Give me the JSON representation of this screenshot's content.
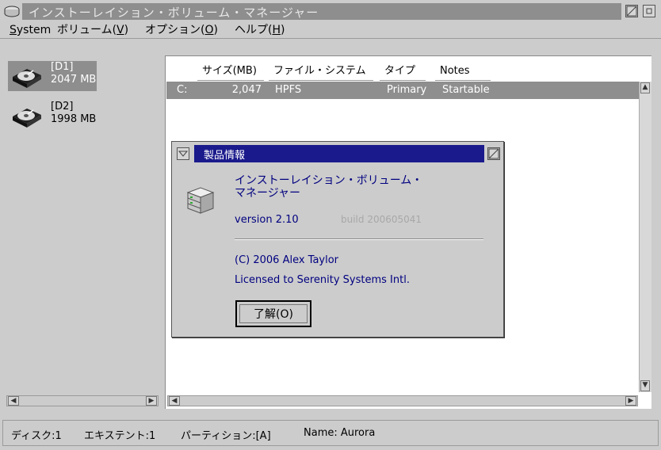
{
  "window": {
    "title": "インストーレイション・ボリューム・マネージャー"
  },
  "menu": [
    {
      "label": "System",
      "key": "S"
    },
    {
      "label": "ボリューム(V)",
      "key": "V"
    },
    {
      "label": "オプション(O)",
      "key": "O"
    },
    {
      "label": "ヘルプ(H)",
      "key": "H"
    }
  ],
  "disks": [
    {
      "name": "[D1]",
      "size": "2047 MB",
      "selected": true
    },
    {
      "name": "[D2]",
      "size": "1998 MB",
      "selected": false
    }
  ],
  "partitions": {
    "columns": [
      "サイズ(MB)",
      "ファイル・システム",
      "タイプ",
      "Notes"
    ],
    "rows": [
      {
        "drive": "C:",
        "size": "2,047",
        "filesystem": "HPFS",
        "type": "Primary",
        "notes": "Startable"
      }
    ]
  },
  "status": {
    "disk": "ディスク:1",
    "extent": "エキステント:1",
    "partition": "パーティション:[A]",
    "name": "Name: Aurora"
  },
  "dialog": {
    "title": "製品情報",
    "product_line1": "インストーレイション・ボリューム・",
    "product_line2": "マネージャー",
    "version": "version 2.10",
    "build": "build 200605041",
    "copyright": "(C) 2006 Alex Taylor",
    "license": "Licensed to Serenity Systems Intl.",
    "ok_label": "了解(O)"
  },
  "colors": {
    "title_active": "#1a1a8c",
    "title_inactive": "#8e8e8e",
    "selection": "#8e8e8e",
    "dialog_text": "#000080"
  },
  "icons": [
    "app-drive-icon",
    "minimize-icon",
    "maximize-icon",
    "hard-disk-icon",
    "scroll-arrow-icon",
    "server-icon"
  ]
}
